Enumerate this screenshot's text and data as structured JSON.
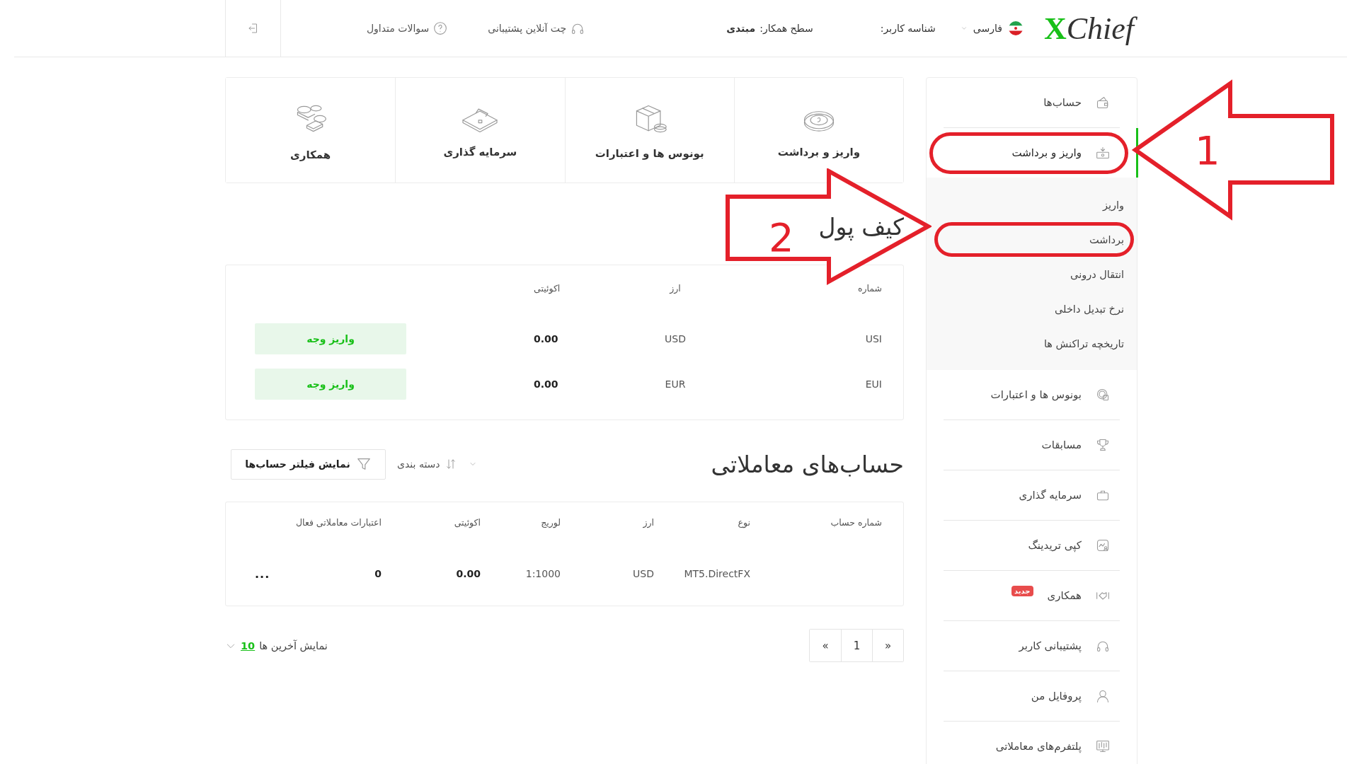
{
  "header": {
    "logo_mark": "X",
    "logo_name": "Chief",
    "language": "فارسی",
    "user_id_label": "شناسه کاربر:",
    "partner_level_label": "سطح همکار:",
    "partner_level": "مبتدی",
    "support_chat": "چت آنلاین پشتیبانی",
    "faq": "سوالات متداول"
  },
  "sidebar": {
    "items": [
      {
        "label": "حساب‌ها",
        "selected": false
      },
      {
        "label": "واریز و برداشت",
        "selected": true,
        "circled": true,
        "children": [
          {
            "label": "واریز",
            "circled": false
          },
          {
            "label": "برداشت",
            "circled": true
          },
          {
            "label": "انتقال درونی",
            "circled": false
          },
          {
            "label": "نرخ تبدیل داخلی",
            "circled": false
          },
          {
            "label": "تاریخچه تراکنش ها",
            "circled": false
          }
        ]
      },
      {
        "label": "بونوس ها و اعتبارات",
        "selected": false
      },
      {
        "label": "مسابقات",
        "selected": false
      },
      {
        "label": "سرمایه گذاری",
        "selected": false
      },
      {
        "label": "کپی تریدینگ",
        "selected": false
      },
      {
        "label": "همکاری",
        "selected": false,
        "badge": "جدید"
      },
      {
        "label": "پشتیبانی کاربر",
        "selected": false
      },
      {
        "label": "پروفایل من",
        "selected": false
      },
      {
        "label": "پلتفرم‌های معاملاتی",
        "selected": false
      }
    ]
  },
  "shortcuts": [
    "واریز و برداشت",
    "بونوس ها و اعتبارات",
    "سرمایه گذاری",
    "همکاری"
  ],
  "wallet": {
    "title": "کیف پول",
    "columns": [
      "شماره",
      "ارز",
      "اکوئیتی"
    ],
    "rows": [
      {
        "account": "USI",
        "currency": "USD",
        "equity": "0.00",
        "action": "واریز وجه"
      },
      {
        "account": "EUI",
        "currency": "EUR",
        "equity": "0.00",
        "action": "واریز وجه"
      }
    ]
  },
  "trading_accounts": {
    "title": "حساب‌های معاملاتی",
    "sort_label": "دسته بندی",
    "filter_button": "نمایش فیلتر حساب‌ها",
    "columns": [
      "شماره حساب",
      "نوع",
      "ارز",
      "لوریج",
      "اکوئیتی",
      "اعتبارات معاملاتی فعال"
    ],
    "rows": [
      {
        "cells": [
          "",
          "MT5.DirectFX",
          "USD",
          "1:1000",
          "0.00",
          "0"
        ],
        "menu": "..."
      }
    ]
  },
  "pagination": {
    "buttons": [
      {
        "label": "«",
        "selected": false
      },
      {
        "label": "1",
        "selected": false
      },
      {
        "label": "»",
        "selected": false
      }
    ]
  },
  "show_last": {
    "label": "نمایش آخرین ها",
    "count": "10"
  },
  "annotations": [
    {
      "kind": "arrow-left",
      "label": "1"
    },
    {
      "kind": "arrow-right",
      "label": "2"
    }
  ]
}
